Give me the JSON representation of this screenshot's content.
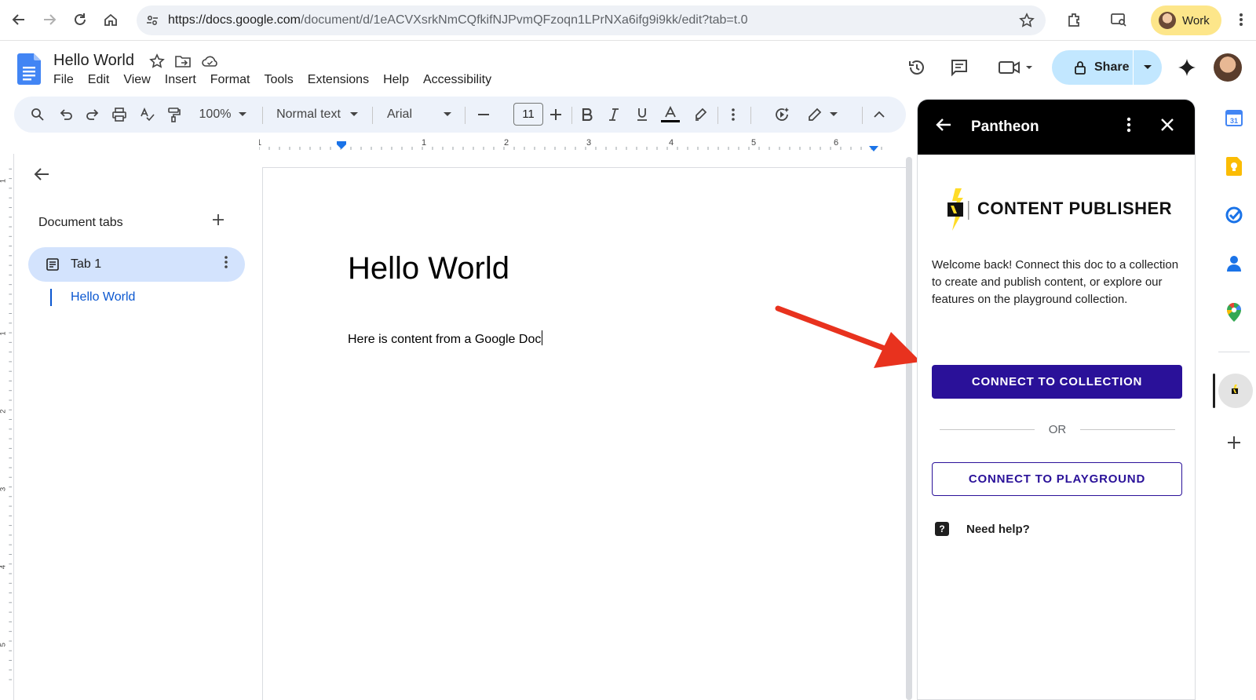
{
  "browser": {
    "url_host": "https://docs.google.com",
    "url_path": "/document/d/1eACVXsrkNmCQfkifNJPvmQFzoqn1LPrNXa6ifg9i9kk/edit?tab=t.0",
    "profile_label": "Work"
  },
  "doc": {
    "title": "Hello World",
    "menu": [
      "File",
      "Edit",
      "View",
      "Insert",
      "Format",
      "Tools",
      "Extensions",
      "Help",
      "Accessibility"
    ],
    "share_label": "Share"
  },
  "toolbar": {
    "zoom": "100%",
    "style": "Normal text",
    "font": "Arial",
    "font_size": "11"
  },
  "ruler": {
    "marks": [
      "1",
      "1",
      "2",
      "3",
      "4",
      "5",
      "6"
    ],
    "vmarks": [
      "1",
      "1",
      "2",
      "3",
      "4",
      "5"
    ]
  },
  "tabs_sidebar": {
    "title": "Document tabs",
    "tab_label": "Tab 1",
    "outline_item": "Hello World"
  },
  "page": {
    "heading": "Hello World",
    "body": "Here is content from a Google Doc"
  },
  "panel": {
    "name": "Pantheon",
    "product": "CONTENT PUBLISHER",
    "welcome": "Welcome back! Connect this doc to a collection to create and publish content, or explore our features on the playground collection.",
    "connect_collection": "CONNECT TO COLLECTION",
    "or": "OR",
    "connect_playground": "CONNECT TO PLAYGROUND",
    "help": "Need help?"
  },
  "colors": {
    "primary_button": "#2a1199",
    "share_bg": "#c2e7ff",
    "toolbar_bg": "#edf2fa",
    "tab_active_bg": "#d3e3fd",
    "annotation_arrow": "#e8321e"
  }
}
